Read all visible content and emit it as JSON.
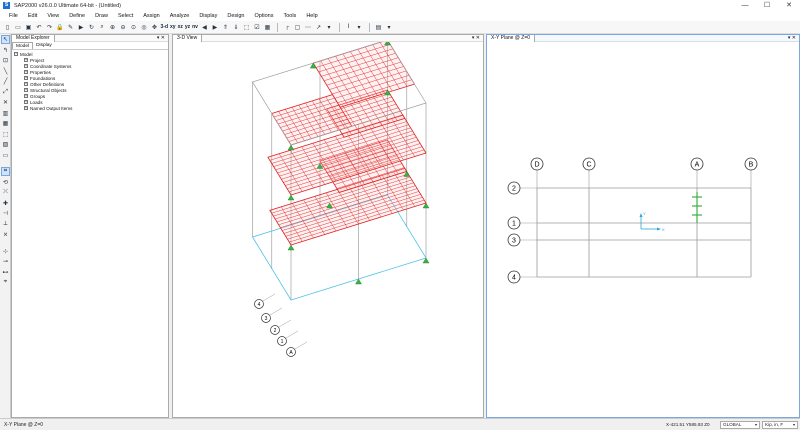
{
  "app": {
    "icon": "S",
    "title": "SAP2000 v26.0.0 Ultimate 64-bit - (Untitled)",
    "window_controls": [
      "—",
      "☐",
      "✕"
    ]
  },
  "menu": [
    "File",
    "Edit",
    "View",
    "Define",
    "Draw",
    "Select",
    "Assign",
    "Analyze",
    "Display",
    "Design",
    "Options",
    "Tools",
    "Help"
  ],
  "toolbar": {
    "view_labels": [
      "3-d",
      "xy",
      "xz",
      "yz",
      "nv"
    ],
    "icons": [
      "new-icon",
      "open-icon",
      "save-icon",
      "undo-icon",
      "redo-icon",
      "lock-icon",
      "pencil-icon",
      "run-icon",
      "refresh-icon",
      "zoom-window-icon",
      "zoom-in-icon",
      "zoom-out-icon",
      "zoom-fit-icon",
      "zoom-prev-icon",
      "pan-icon"
    ]
  },
  "explorer": {
    "tab": "Model Explorer",
    "subtabs": [
      "Model",
      "Display"
    ],
    "root": "Model",
    "items": [
      "Project",
      "Coordinate Systems",
      "Properties",
      "Foundations",
      "Other Definitions",
      "Structural Objects",
      "Groups",
      "Loads",
      "Named Output Items"
    ],
    "controls": "▾ ✕"
  },
  "view3d": {
    "tab": "3-D View",
    "controls": "▾ ✕",
    "grid_bubbles": [
      "4",
      "3",
      "2",
      "1",
      "A"
    ]
  },
  "viewxy": {
    "tab": "X-Y Plane @ Z=0",
    "controls": "▾ ✕",
    "col_bubbles": [
      "D",
      "C",
      "A",
      "B"
    ],
    "row_bubbles": [
      "2",
      "1",
      "3",
      "4"
    ],
    "axis_x": "X",
    "axis_y": "Y"
  },
  "status": {
    "view_name": "X-Y Plane @ Z=0",
    "coords": "X-421.51  Y585.93  Z0",
    "coord_system": "GLOBAL",
    "units": "Kip, in, F"
  },
  "colors": {
    "slab_mesh": "#e02020",
    "frame": "#a0a0a0",
    "support": "#3cb043",
    "active_border": "#7aa7e0"
  }
}
